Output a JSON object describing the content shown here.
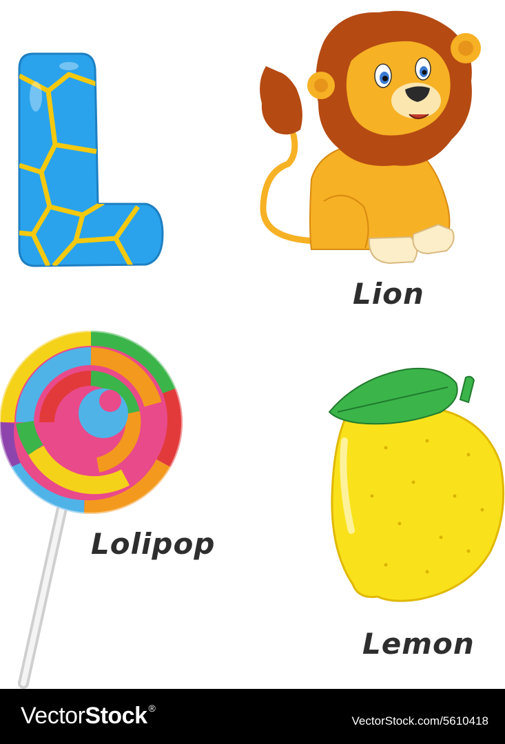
{
  "letter": "L",
  "items": [
    {
      "word": "Lion",
      "icon": "lion-icon"
    },
    {
      "word": "Lolipop",
      "icon": "lollipop-icon"
    },
    {
      "word": "Lemon",
      "icon": "lemon-icon"
    }
  ],
  "footer": {
    "brand_regular": "Vector",
    "brand_bold": "Stock",
    "brand_mark": "®",
    "image_id": "VectorStock.com/5610418"
  },
  "colors": {
    "letter_blue": "#2aa3ec",
    "letter_lines": "#f5c90f",
    "lion_body": "#f7b124",
    "lion_mane": "#b54a12",
    "lemon": "#f9e21b",
    "leaf": "#3bb54a",
    "footer_bg": "#000000"
  }
}
